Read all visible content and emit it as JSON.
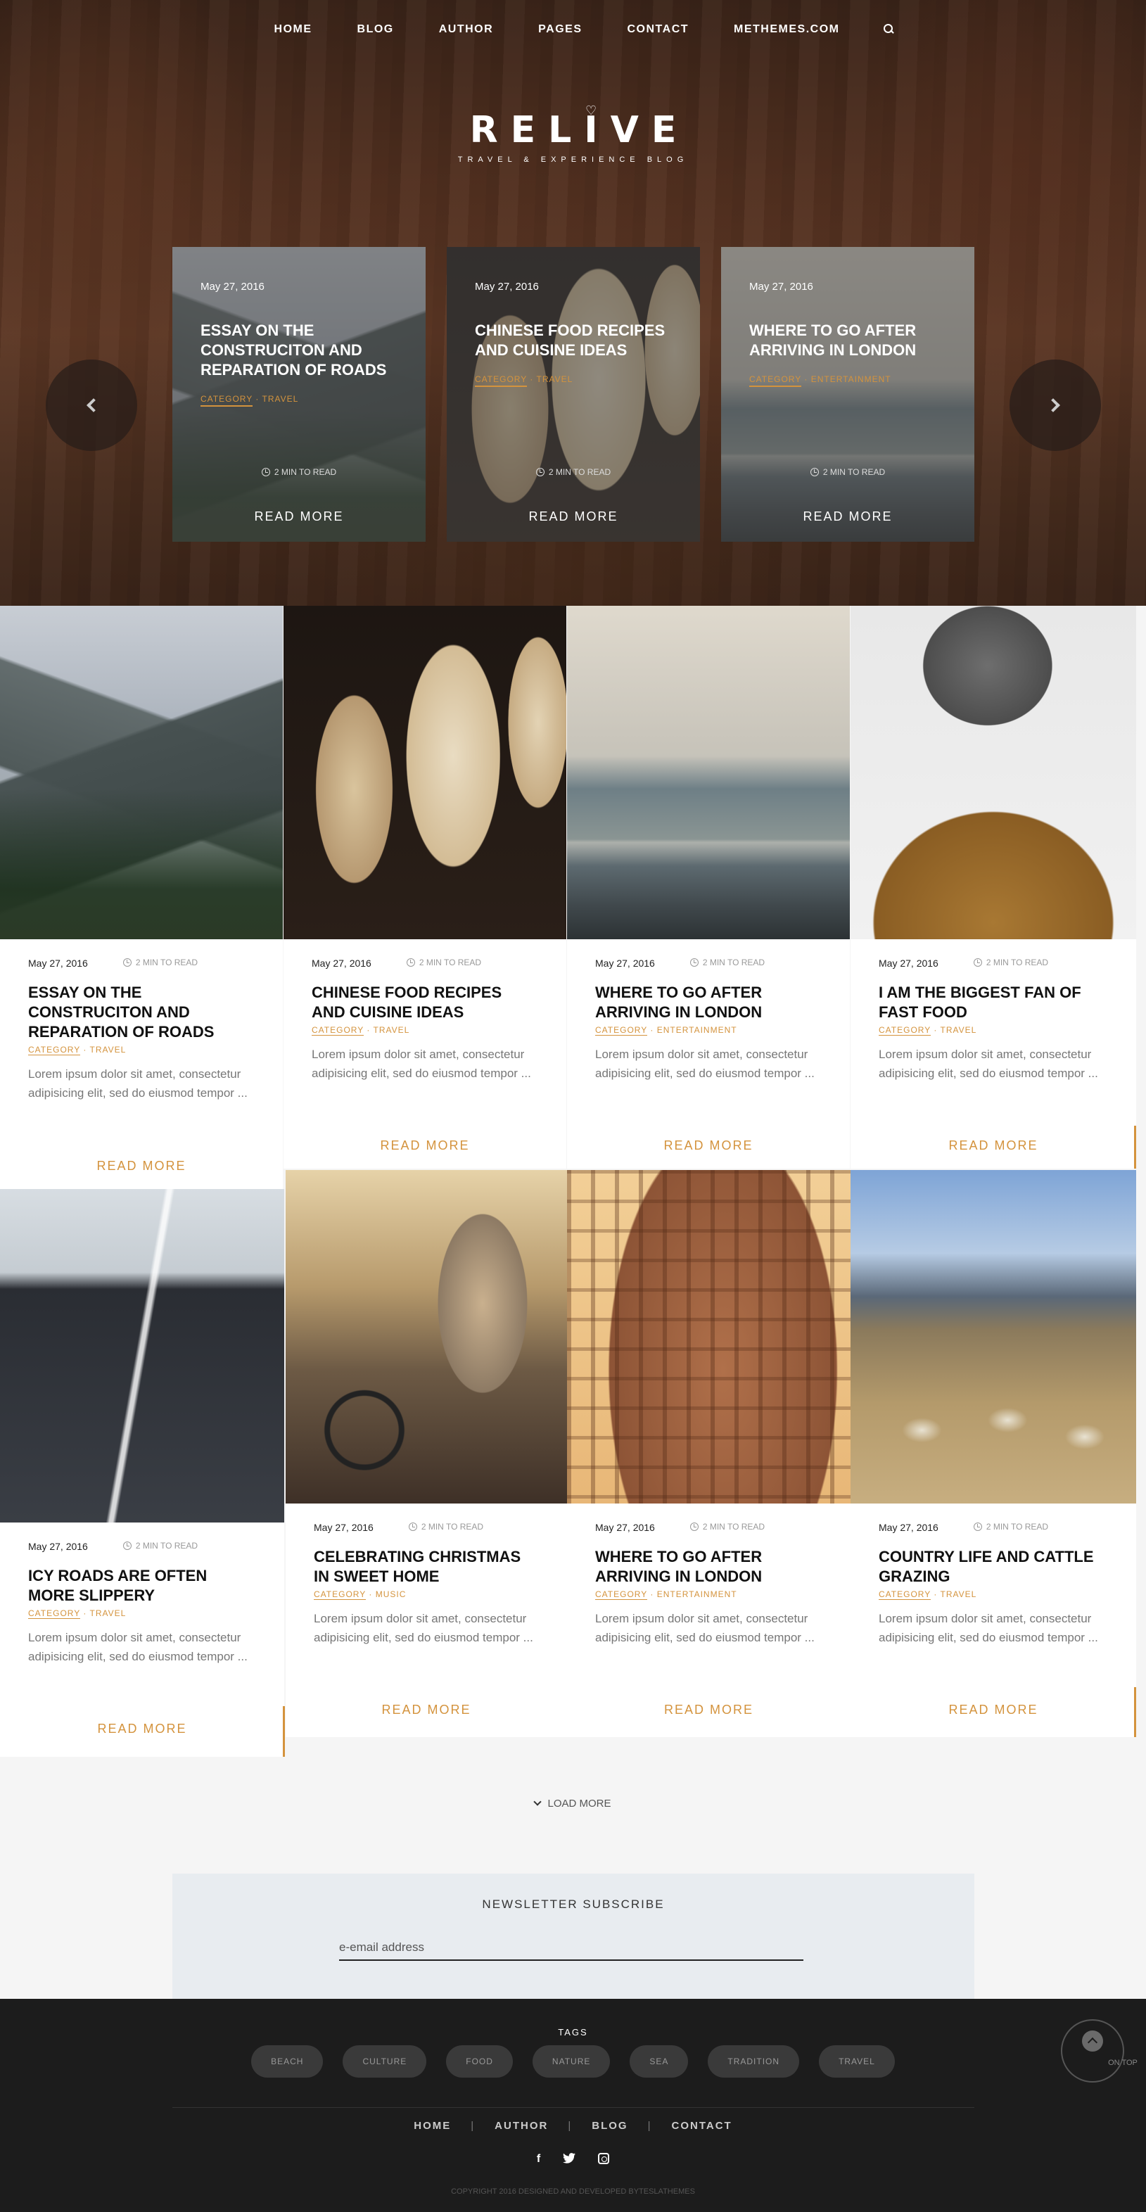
{
  "colors": {
    "accent": "#d4933d",
    "footer_bg": "#1c1c1c",
    "newsletter_bg": "#e8ecf0"
  },
  "nav": {
    "items": [
      "HOME",
      "BLOG",
      "AUTHOR",
      "PAGES",
      "CONTACT",
      "METHEMES.COM"
    ],
    "search_icon": "search-icon"
  },
  "logo": {
    "text": "RELIVE",
    "tagline": "TRAVEL & EXPERIENCE BLOG"
  },
  "slider": {
    "slides": [
      {
        "date": "May 27, 2016",
        "title": "ESSAY ON THE CONSTRUCITON AND REPARATION OF ROADS",
        "cat1": "CATEGORY",
        "cat2": "TRAVEL",
        "read_time": "2 MIN TO READ",
        "read_more": "READ MORE"
      },
      {
        "date": "May 27, 2016",
        "title": "CHINESE FOOD RECIPES AND CUISINE IDEAS",
        "cat1": "CATEGORY",
        "cat2": "TRAVEL",
        "read_time": "2 MIN TO READ",
        "read_more": "READ MORE"
      },
      {
        "date": "May 27, 2016",
        "title": "WHERE TO GO AFTER ARRIVING IN LONDON",
        "cat1": "CATEGORY",
        "cat2": "ENTERTAINMENT",
        "read_time": "2 MIN TO READ",
        "read_more": "READ MORE"
      }
    ]
  },
  "posts": [
    {
      "date": "May 27, 2016",
      "read_time": "2 MIN TO READ",
      "title": "ESSAY ON THE CONSTRUCITON AND REPARATION OF ROADS",
      "cat1": "CATEGORY",
      "cat2": "TRAVEL",
      "excerpt": "Lorem ipsum dolor sit amet, consectetur adipisicing elit, sed do eiusmod tempor ...",
      "read_more": "READ MORE"
    },
    {
      "date": "May 27, 2016",
      "read_time": "2 MIN TO READ",
      "title": "CHINESE FOOD RECIPES AND CUISINE IDEAS",
      "cat1": "CATEGORY",
      "cat2": "TRAVEL",
      "excerpt": "Lorem ipsum dolor sit amet, consectetur adipisicing elit, sed do eiusmod tempor ...",
      "read_more": "READ MORE"
    },
    {
      "date": "May 27, 2016",
      "read_time": "2 MIN TO READ",
      "title": "WHERE TO GO AFTER ARRIVING IN LONDON",
      "cat1": "CATEGORY",
      "cat2": "ENTERTAINMENT",
      "excerpt": "Lorem ipsum dolor sit amet, consectetur adipisicing elit, sed do eiusmod tempor ...",
      "read_more": "READ MORE"
    },
    {
      "date": "May 27, 2016",
      "read_time": "2 MIN TO READ",
      "title": "I AM THE BIGGEST FAN OF FAST FOOD",
      "cat1": "CATEGORY",
      "cat2": "TRAVEL",
      "excerpt": "Lorem ipsum dolor sit amet, consectetur adipisicing elit, sed do eiusmod tempor ...",
      "read_more": "READ MORE"
    },
    {
      "date": "May 27, 2016",
      "read_time": "2 MIN TO READ",
      "title": "ICY ROADS ARE OFTEN MORE SLIPPERY",
      "cat1": "CATEGORY",
      "cat2": "TRAVEL",
      "excerpt": "Lorem ipsum dolor sit amet, consectetur adipisicing elit, sed do eiusmod tempor ...",
      "read_more": "READ MORE"
    },
    {
      "date": "May 27, 2016",
      "read_time": "2 MIN TO READ",
      "title": "CELEBRATING CHRISTMAS IN SWEET HOME",
      "cat1": "CATEGORY",
      "cat2": "MUSIC",
      "excerpt": "Lorem ipsum dolor sit amet, consectetur adipisicing elit, sed do eiusmod tempor ...",
      "read_more": "READ MORE"
    },
    {
      "date": "May 27, 2016",
      "read_time": "2 MIN TO READ",
      "title": "WHERE TO GO AFTER ARRIVING IN LONDON",
      "cat1": "CATEGORY",
      "cat2": "ENTERTAINMENT",
      "excerpt": "Lorem ipsum dolor sit amet, consectetur adipisicing elit, sed do eiusmod tempor ...",
      "read_more": "READ MORE"
    },
    {
      "date": "May 27, 2016",
      "read_time": "2 MIN TO READ",
      "title": "COUNTRY LIFE AND CATTLE GRAZING",
      "cat1": "CATEGORY",
      "cat2": "TRAVEL",
      "excerpt": "Lorem ipsum dolor sit amet, consectetur adipisicing elit, sed do eiusmod tempor ...",
      "read_more": "READ MORE"
    }
  ],
  "load_more": "LOAD MORE",
  "newsletter": {
    "title": "NEWSLETTER SUBSCRIBE",
    "placeholder": "e-email address"
  },
  "footer": {
    "tags_title": "TAGS",
    "tags": [
      "BEACH",
      "CULTURE",
      "FOOD",
      "NATURE",
      "SEA",
      "TRADITION",
      "TRAVEL"
    ],
    "nav": [
      "HOME",
      "AUTHOR",
      "BLOG",
      "CONTACT"
    ],
    "nav_separator": "|",
    "social": {
      "facebook": "f",
      "twitter_icon": "twitter-icon",
      "instagram_icon": "instagram-icon"
    },
    "copyright": "COPYRIGHT 2016 DESIGNED AND DEVELOPED BYTESLATHEMES",
    "on_top": "ON TOP"
  }
}
